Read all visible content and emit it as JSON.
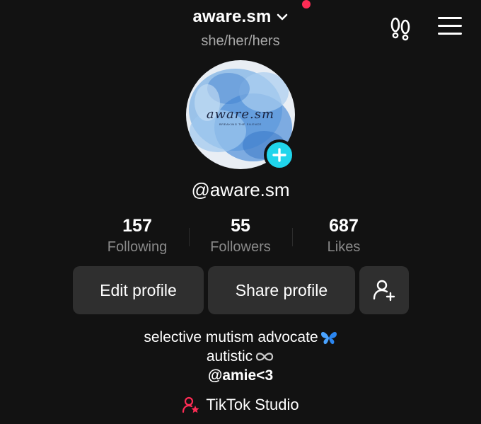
{
  "header": {
    "username": "aware.sm",
    "pronouns": "she/her/hers",
    "icons": [
      "chevron-down-icon",
      "notification-dot",
      "footprint-icon",
      "hamburger-menu-icon"
    ]
  },
  "profile": {
    "avatar_title": "aware.sm",
    "avatar_subtitle": "BREAKING THE SILENCE",
    "handle": "@aware.sm"
  },
  "stats": [
    {
      "value": "157",
      "label": "Following"
    },
    {
      "value": "55",
      "label": "Followers"
    },
    {
      "value": "687",
      "label": "Likes"
    }
  ],
  "actions": {
    "edit_profile": "Edit profile",
    "share_profile": "Share profile",
    "add_friend_icon": "add-user-icon"
  },
  "bio": {
    "line1": "selective mutism advocate",
    "line2": "autistic",
    "line3": "@amie<3"
  },
  "studio": {
    "label": "TikTok Studio"
  },
  "colors": {
    "background": "#121212",
    "button_bg": "#2f2f2f",
    "accent_red": "#fe2c55",
    "accent_cyan": "#20d5ec",
    "muted_text": "#8a8a8a",
    "butterfly": "#4aa3ff"
  }
}
